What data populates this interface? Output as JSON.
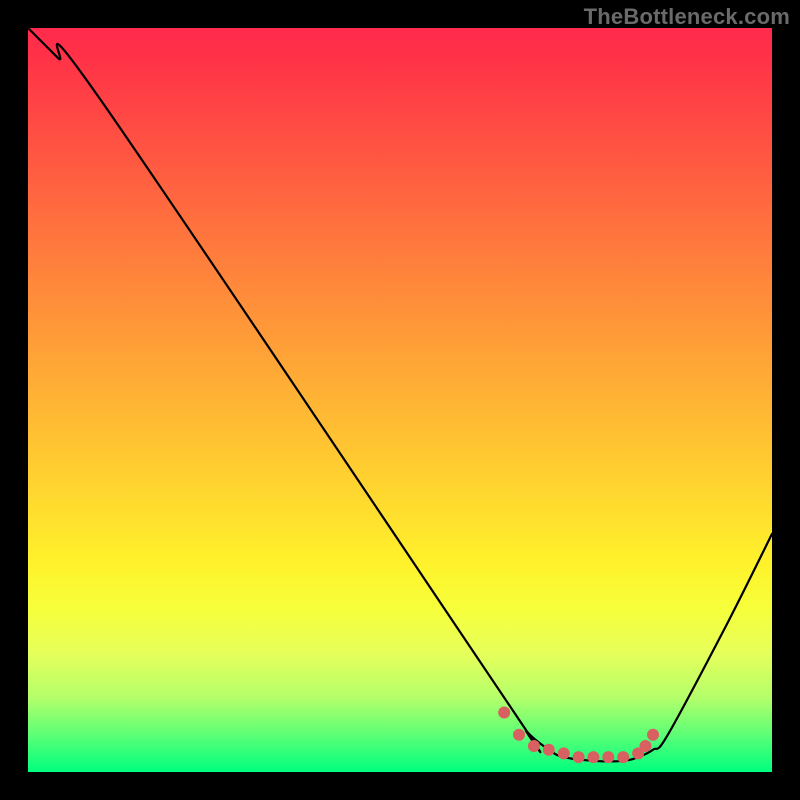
{
  "watermark": "TheBottleneck.com",
  "colors": {
    "frame_bg": "#000000",
    "watermark": "#6a6a6a",
    "curve_stroke": "#000000",
    "dot_fill": "#d86060",
    "gradient_top": "#ff2a4c",
    "gradient_bottom": "#00ff7e"
  },
  "chart_data": {
    "type": "line",
    "title": "",
    "xlabel": "",
    "ylabel": "",
    "xlim": [
      0,
      100
    ],
    "ylim": [
      0,
      100
    ],
    "grid": false,
    "legend": false,
    "series": [
      {
        "name": "curve",
        "x": [
          0,
          4,
          10,
          64,
          67,
          70,
          72,
          76,
          80,
          82,
          84,
          86,
          94,
          100
        ],
        "values": [
          100,
          96,
          90,
          10,
          5.5,
          3,
          2,
          1.5,
          1.5,
          2,
          3,
          5,
          20,
          32
        ]
      }
    ],
    "markers": {
      "name": "highlight-dots",
      "x": [
        64,
        66,
        68,
        70,
        72,
        74,
        76,
        78,
        80,
        82,
        83,
        84
      ],
      "values": [
        8,
        5,
        3.5,
        3,
        2.5,
        2,
        2,
        2,
        2,
        2.5,
        3.5,
        5
      ]
    },
    "gradient_stops": [
      {
        "pos": 0,
        "color": "#ff2a4c"
      },
      {
        "pos": 4,
        "color": "#ff3247"
      },
      {
        "pos": 12,
        "color": "#ff4844"
      },
      {
        "pos": 24,
        "color": "#ff6a3f"
      },
      {
        "pos": 36,
        "color": "#ff8c3a"
      },
      {
        "pos": 48,
        "color": "#ffae35"
      },
      {
        "pos": 60,
        "color": "#ffd030"
      },
      {
        "pos": 72,
        "color": "#fff22b"
      },
      {
        "pos": 78,
        "color": "#f6ff3a"
      },
      {
        "pos": 84,
        "color": "#e6ff5a"
      },
      {
        "pos": 90,
        "color": "#b4ff6a"
      },
      {
        "pos": 95,
        "color": "#5cff76"
      },
      {
        "pos": 100,
        "color": "#00ff7e"
      }
    ]
  }
}
